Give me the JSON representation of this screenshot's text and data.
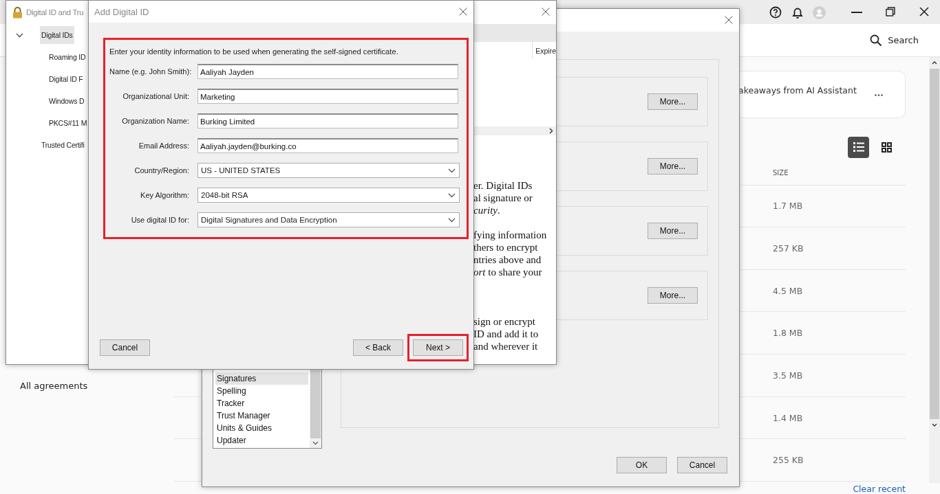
{
  "app": {
    "search": {
      "label": "Search"
    },
    "card": {
      "text": "akeaways from AI Assistant"
    },
    "view_toggle": [
      {
        "kind": "list",
        "selected": true
      },
      {
        "kind": "grid",
        "selected": false
      }
    ],
    "table": {
      "columns": [
        "SIZE"
      ],
      "rows": [
        {
          "size": "1.7 MB"
        },
        {
          "size": "257 KB"
        },
        {
          "size": "4.5 MB"
        },
        {
          "size": "1.8 MB"
        },
        {
          "size": "3.5 MB"
        },
        {
          "size": "1.4 MB"
        },
        {
          "size": "255 KB"
        }
      ]
    },
    "sidebar_link": "All agreements",
    "clear_recent": "Clear recent"
  },
  "preferences": {
    "categories": [
      {
        "label": "Signatures",
        "selected": true
      },
      {
        "label": "Spelling",
        "selected": false
      },
      {
        "label": "Tracker",
        "selected": false
      },
      {
        "label": "Trust Manager",
        "selected": false
      },
      {
        "label": "Units & Guides",
        "selected": false
      },
      {
        "label": "Updater",
        "selected": false
      }
    ],
    "more_buttons": [
      "More...",
      "More...",
      "More...",
      "More..."
    ],
    "buttons": [
      "OK",
      "Cancel"
    ]
  },
  "digital_id_window": {
    "title": "Digital ID and Tru",
    "tree": [
      {
        "label": "Digital IDs",
        "expanded": true,
        "selected": true,
        "children": [
          {
            "label": "Roaming ID",
            "selected": false
          },
          {
            "label": "Digital ID F",
            "selected": false
          },
          {
            "label": "Windows D",
            "selected": false
          },
          {
            "label": "PKCS#11 M",
            "selected": false
          }
        ]
      },
      {
        "label": "Trusted Certifi",
        "selected": false
      }
    ],
    "column_header": "Expire",
    "description": [
      [
        "er. Digital IDs",
        "al signature or",
        "*curity*."
      ],
      [
        "fying information",
        "thers to encrypt",
        "ntries above and",
        "*ort* to share your"
      ],
      [
        "sign or encrypt",
        "ID and add it to",
        "and wherever it"
      ]
    ]
  },
  "dialog": {
    "title": "Add Digital ID",
    "highlighted": true,
    "intro": "Enter your identity information to be used when generating the self-signed certificate.",
    "fields": [
      {
        "kind": "text",
        "label": "Name (e.g. John Smith):",
        "value": "Aaliyah Jayden"
      },
      {
        "kind": "text",
        "label": "Organizational Unit:",
        "value": "Marketing"
      },
      {
        "kind": "text",
        "label": "Organization Name:",
        "value": "Burking Limited"
      },
      {
        "kind": "text",
        "label": "Email Address:",
        "value": "Aaliyah.jayden@burking.co"
      },
      {
        "kind": "select",
        "label": "Country/Region:",
        "value": "US - UNITED STATES"
      },
      {
        "kind": "select",
        "label": "Key Algorithm:",
        "value": "2048-bit RSA"
      },
      {
        "kind": "select",
        "label": "Use digital ID for:",
        "value": "Digital Signatures and Data Encryption"
      }
    ],
    "buttons": [
      {
        "label": "Cancel",
        "highlighted": false
      },
      {
        "label": "< Back",
        "highlighted": false
      },
      {
        "label": "Next >",
        "highlighted": true
      }
    ]
  }
}
